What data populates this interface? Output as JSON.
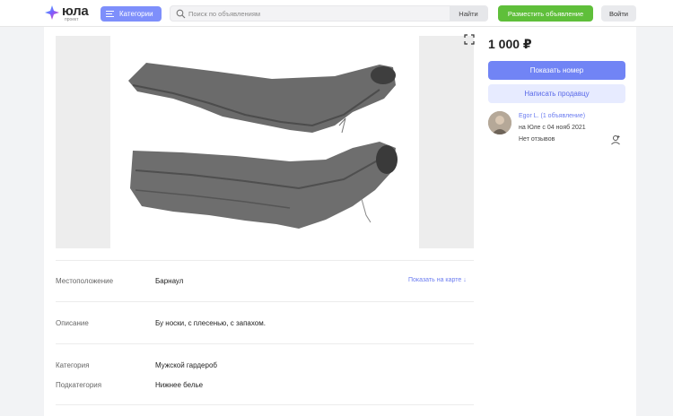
{
  "header": {
    "logo_text": "юла",
    "logo_sub": "проект",
    "categories_label": "Категории",
    "search_placeholder": "Поиск по объявлениям",
    "find_label": "Найти",
    "post_label": "Разместить объявление",
    "login_label": "Войти"
  },
  "listing": {
    "price": "1 000 ₽",
    "show_number_label": "Показать номер",
    "write_seller_label": "Написать продавцу",
    "seller": {
      "name": "Egor L. (1 объявление)",
      "since": "на Юле с 04 нояб 2021",
      "reviews": "Нет отзывов"
    },
    "details": {
      "location_label": "Местоположение",
      "location_value": "Барнаул",
      "map_link": "Показать на карте ↓",
      "description_label": "Описание",
      "description_value": "Бу носки, с плесенью, с запахом.",
      "category_label": "Категория",
      "category_value": "Мужской гардероб",
      "subcategory_label": "Подкатегория",
      "subcategory_value": "Нижнее белье"
    }
  },
  "colors": {
    "accent_blue": "#7184f5",
    "accent_green": "#5fbf3a",
    "link": "#6b7cf0"
  }
}
